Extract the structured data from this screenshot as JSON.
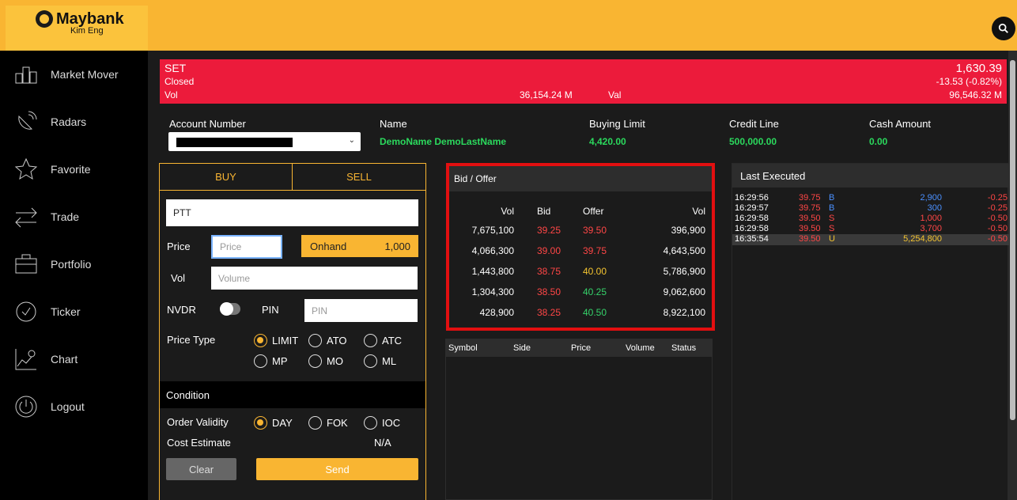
{
  "header": {
    "brand": "Maybank",
    "brand_sub": "Kim Eng",
    "search_icon": "search-icon"
  },
  "sidebar": {
    "items": [
      {
        "label": "Market Mover",
        "icon": "market-mover-icon"
      },
      {
        "label": "Radars",
        "icon": "radar-dish-icon"
      },
      {
        "label": "Favorite",
        "icon": "star-icon"
      },
      {
        "label": "Trade",
        "icon": "trade-arrows-icon"
      },
      {
        "label": "Portfolio",
        "icon": "briefcase-icon"
      },
      {
        "label": "Ticker",
        "icon": "ticker-clock-icon"
      },
      {
        "label": "Chart",
        "icon": "chart-icon"
      },
      {
        "label": "Logout",
        "icon": "power-icon"
      }
    ]
  },
  "index_bar": {
    "name": "SET",
    "status": "Closed",
    "vol_label": "Vol",
    "vol_value": "36,154.24 M",
    "val_label": "Val",
    "last": "1,630.39",
    "change": "-13.53  (-0.82%)",
    "val_value": "96,546.32 M",
    "color": "#ec1b3b"
  },
  "account": {
    "account_number_label": "Account Number",
    "name_label": "Name",
    "name_value": "DemoName DemoLastName",
    "buying_limit_label": "Buying Limit",
    "buying_limit_value": "4,420.00",
    "credit_line_label": "Credit Line",
    "credit_line_value": "500,000.00",
    "cash_amount_label": "Cash Amount",
    "cash_amount_value": "0.00"
  },
  "order": {
    "buy_tab": "BUY",
    "sell_tab": "SELL",
    "symbol": "PTT",
    "price_label": "Price",
    "price_placeholder": "Price",
    "onhand_label": "Onhand",
    "onhand_value": "1,000",
    "vol_label": "Vol",
    "vol_placeholder": "Volume",
    "nvdr_label": "NVDR",
    "pin_label": "PIN",
    "pin_placeholder": "PIN",
    "price_type_label": "Price Type",
    "price_types": [
      "LIMIT",
      "ATO",
      "ATC",
      "MP",
      "MO",
      "ML"
    ],
    "price_type_selected": "LIMIT",
    "condition_label": "Condition",
    "order_validity_label": "Order Validity",
    "validity_options": [
      "DAY",
      "FOK",
      "IOC"
    ],
    "validity_selected": "DAY",
    "cost_estimate_label": "Cost Estimate",
    "cost_estimate_value": "N/A",
    "clear_label": "Clear",
    "send_label": "Send"
  },
  "bid_offer": {
    "title": "Bid / Offer",
    "headers": [
      "Vol",
      "Bid",
      "Offer",
      "Vol"
    ],
    "rows": [
      {
        "bid_vol": "7,675,100",
        "bid": "39.25",
        "offer": "39.50",
        "offer_vol": "396,900"
      },
      {
        "bid_vol": "4,066,300",
        "bid": "39.00",
        "offer": "39.75",
        "offer_vol": "4,643,500"
      },
      {
        "bid_vol": "1,443,800",
        "bid": "38.75",
        "offer": "40.00",
        "offer_vol": "5,786,900"
      },
      {
        "bid_vol": "1,304,300",
        "bid": "38.50",
        "offer": "40.25",
        "offer_vol": "9,062,600"
      },
      {
        "bid_vol": "428,900",
        "bid": "38.25",
        "offer": "40.50",
        "offer_vol": "8,922,100"
      }
    ]
  },
  "orders_table": {
    "headers": [
      "Symbol",
      "Side",
      "Price",
      "Volume",
      "Status"
    ]
  },
  "last_executed": {
    "title": "Last Executed",
    "rows": [
      {
        "time": "16:29:56",
        "price": "39.75",
        "side": "B",
        "vol": "2,900",
        "chg": "-0.25"
      },
      {
        "time": "16:29:57",
        "price": "39.75",
        "side": "B",
        "vol": "300",
        "chg": "-0.25"
      },
      {
        "time": "16:29:58",
        "price": "39.50",
        "side": "S",
        "vol": "1,000",
        "chg": "-0.50"
      },
      {
        "time": "16:29:58",
        "price": "39.50",
        "side": "S",
        "vol": "3,700",
        "chg": "-0.50"
      },
      {
        "time": "16:35:54",
        "price": "39.50",
        "side": "U",
        "vol": "5,254,800",
        "chg": "-0.50"
      }
    ]
  },
  "colors": {
    "brand_yellow": "#f9b532",
    "up_green": "#2bd95d",
    "down_red": "#ff4646",
    "highlight_border": "#e20f10"
  }
}
